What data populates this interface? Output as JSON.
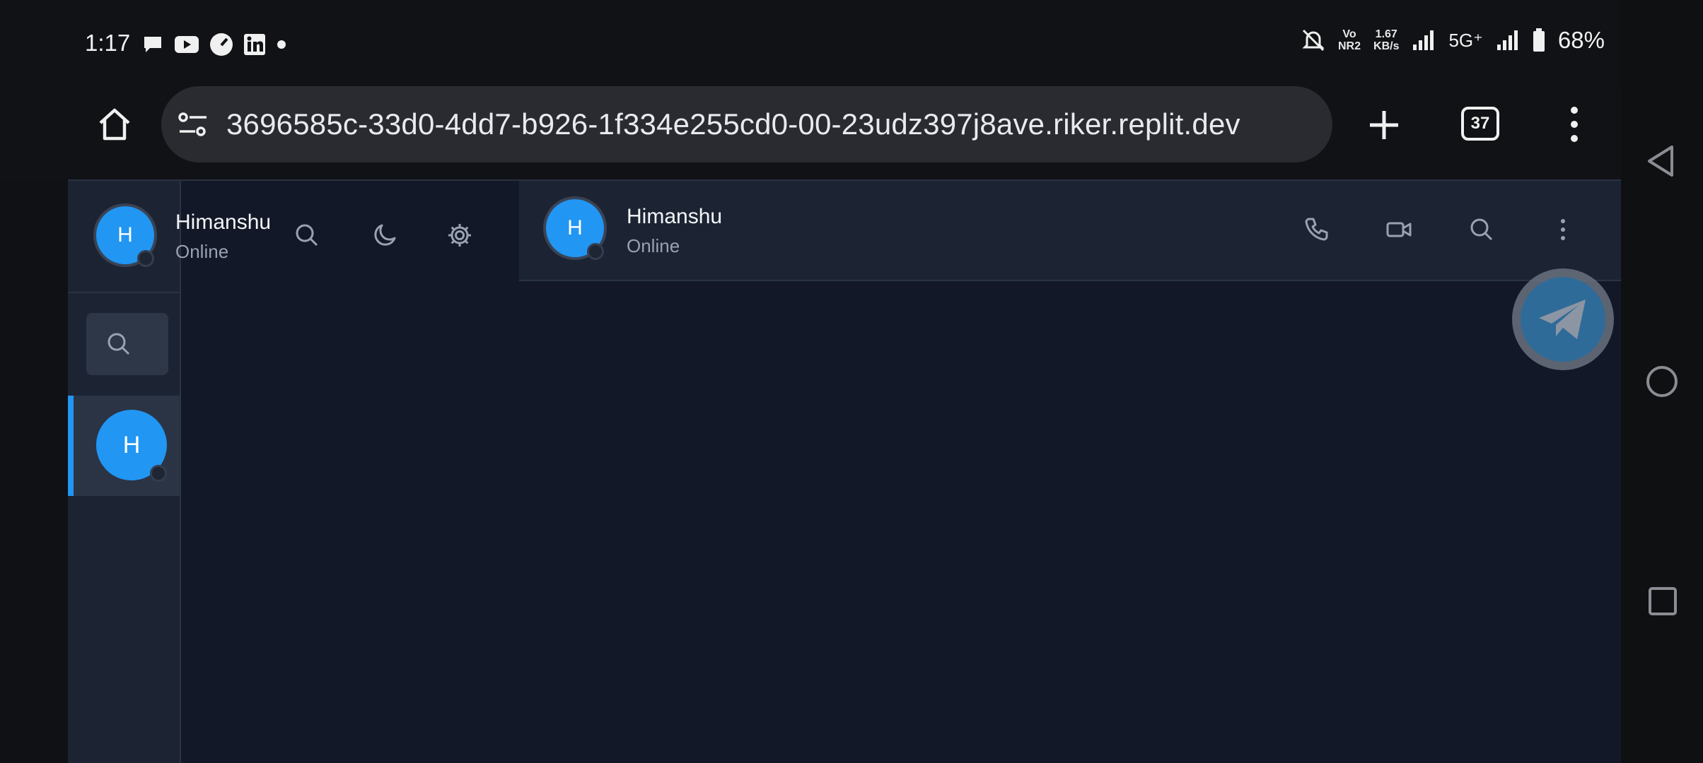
{
  "status_bar": {
    "time": "1:17",
    "speed_value": "1.67",
    "speed_unit": "KB/s",
    "volte_top": "Vo",
    "volte_bottom": "NR2",
    "network": "5G⁺",
    "battery": "68%",
    "left_icons": [
      "chat-bubble-icon",
      "youtube-icon",
      "speedometer-icon",
      "linkedin-icon",
      "dot-icon"
    ],
    "right_icons": [
      "mute-icon",
      "signal-icon",
      "signal-icon",
      "battery-icon"
    ]
  },
  "browser": {
    "url": "3696585c-33d0-4dd7-b926-1f334e255cd0-00-23udz397j8ave.riker.replit.dev",
    "tab_count": "37",
    "icons": [
      "home-icon",
      "site-settings-icon",
      "new-tab-icon",
      "tabs-icon",
      "more-vert-icon"
    ]
  },
  "sidebar": {
    "user": {
      "initial": "H",
      "name": "Himanshu",
      "status": "Online"
    },
    "actions": [
      "search-icon",
      "moon-icon",
      "gear-icon"
    ],
    "chats": [
      {
        "initial": "H"
      }
    ]
  },
  "chat": {
    "initial": "H",
    "name": "Himanshu",
    "status": "Online",
    "actions": [
      "phone-icon",
      "video-icon",
      "search-icon",
      "more-vert-icon"
    ]
  },
  "theme": {
    "accent": "#2196f3",
    "panel": "#1c2434",
    "background": "#121827"
  }
}
